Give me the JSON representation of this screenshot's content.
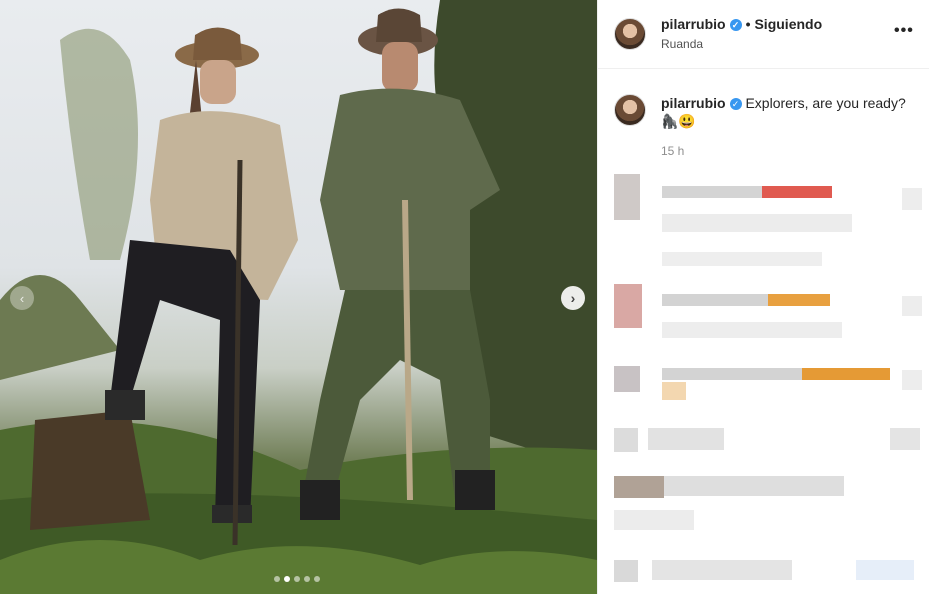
{
  "post": {
    "username": "pilarrubio",
    "verified_icon": "verified-badge-icon",
    "separator": "•",
    "follow_status": "Siguiendo",
    "location": "Ruanda",
    "more_icon": "•••",
    "caption_username": "pilarrubio",
    "caption_text": "Explorers, are you ready? 🦍😃",
    "time_ago": "15 h"
  },
  "carousel": {
    "prev_icon": "‹",
    "next_icon": "›",
    "slide_count": 5,
    "active_slide": 2
  },
  "colors": {
    "verified": "#3897f0",
    "divider": "#efefef",
    "muted": "#8e8e8e"
  }
}
